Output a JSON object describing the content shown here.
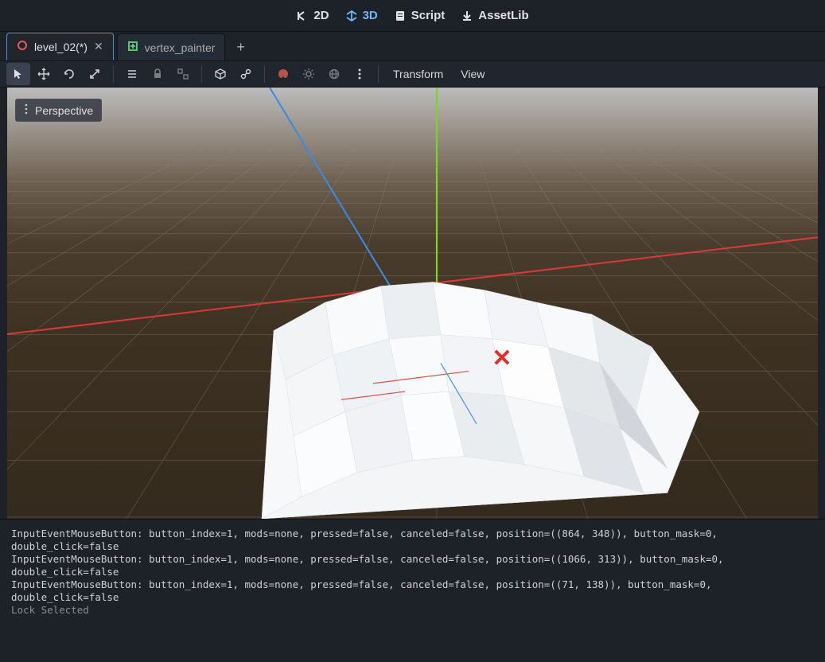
{
  "top_bar": {
    "items": [
      {
        "label": "2D",
        "icon": "2d"
      },
      {
        "label": "3D",
        "icon": "3d",
        "active": true
      },
      {
        "label": "Script",
        "icon": "script"
      },
      {
        "label": "AssetLib",
        "icon": "download"
      }
    ]
  },
  "tabs": {
    "items": [
      {
        "label": "level_02(*)",
        "icon": "circle-red",
        "active": true,
        "closable": true
      },
      {
        "label": "vertex_painter",
        "icon": "square-green",
        "active": false,
        "closable": false
      }
    ]
  },
  "toolbar": {
    "mode_buttons": [
      "select",
      "move",
      "rotate",
      "scale"
    ],
    "extra_buttons_a": [
      "list",
      "lock",
      "group"
    ],
    "extra_buttons_b": [
      "cube",
      "link"
    ],
    "extra_buttons_c": [
      "paint",
      "sun",
      "globe",
      "more"
    ],
    "menus": [
      "Transform",
      "View"
    ]
  },
  "viewport": {
    "perspective_label": "Perspective",
    "marker": "✕",
    "axes": {
      "x_color": "#e83a3a",
      "y_color": "#7ad61f",
      "z_color": "#3a8ae8"
    }
  },
  "console": {
    "lines": [
      "InputEventMouseButton: button_index=1, mods=none, pressed=false, canceled=false, position=((864, 348)), button_mask=0, double_click=false",
      "InputEventMouseButton: button_index=1, mods=none, pressed=false, canceled=false, position=((1066, 313)), button_mask=0, double_click=false",
      "InputEventMouseButton: button_index=1, mods=none, pressed=false, canceled=false, position=((71, 138)), button_mask=0, double_click=false",
      "Lock Selected"
    ]
  }
}
